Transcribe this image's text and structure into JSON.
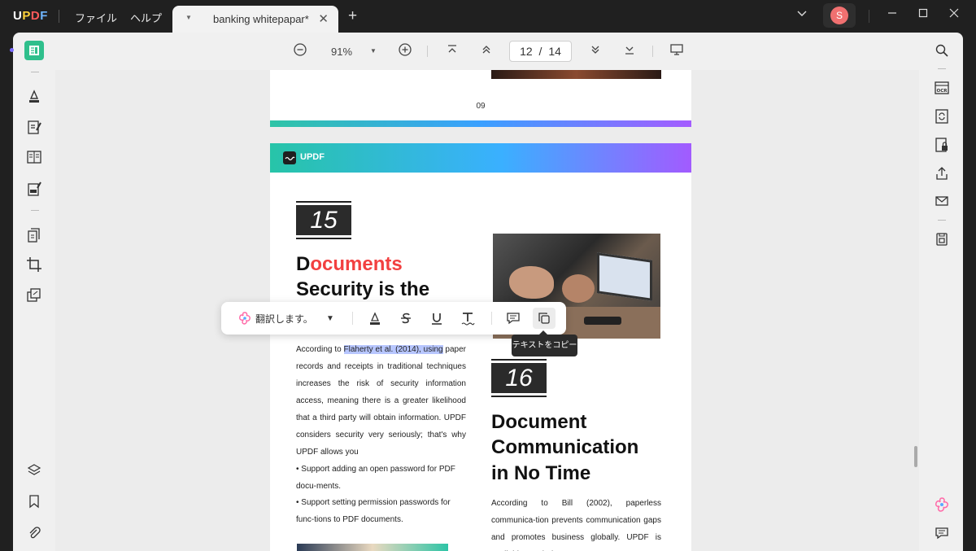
{
  "titlebar": {
    "logo": [
      "U",
      "P",
      "D",
      "F"
    ],
    "menu": [
      "ファイル",
      "ヘルプ"
    ],
    "tab_title": "banking whitepapar*",
    "avatar_letter": "S"
  },
  "toolbar": {
    "zoom": "91%",
    "current_page": "12",
    "page_separator": "/",
    "total_pages": "14"
  },
  "page": {
    "page_number": "09",
    "banner_text": "UPDF",
    "section15": {
      "number": "15",
      "heading_first_letter": "D",
      "heading_red": "ocuments",
      "heading_line2": "Security is the",
      "para_prefix": "According to ",
      "para_highlight": "Flaherty et al. (2014), using",
      "para_rest": " paper records and receipts in traditional techniques increases the risk of security information access, meaning there is a greater likelihood that a third party will obtain information. UPDF considers security very seriously; that's why UPDF allows you",
      "bullet1": "• Support adding an open password for PDF docu-ments.",
      "bullet2": "• Support setting permission passwords for func-tions to PDF documents."
    },
    "section16": {
      "number": "16",
      "heading_lines": [
        "Document",
        "Communication",
        "in No Time"
      ],
      "para": "According to Bill (2002), paperless communica-tion prevents communication gaps and promotes business globally. UPDF is available to Windows,"
    }
  },
  "floating_toolbar": {
    "translate_label": "翻訳します。",
    "tooltip": "テキストをコピー"
  }
}
